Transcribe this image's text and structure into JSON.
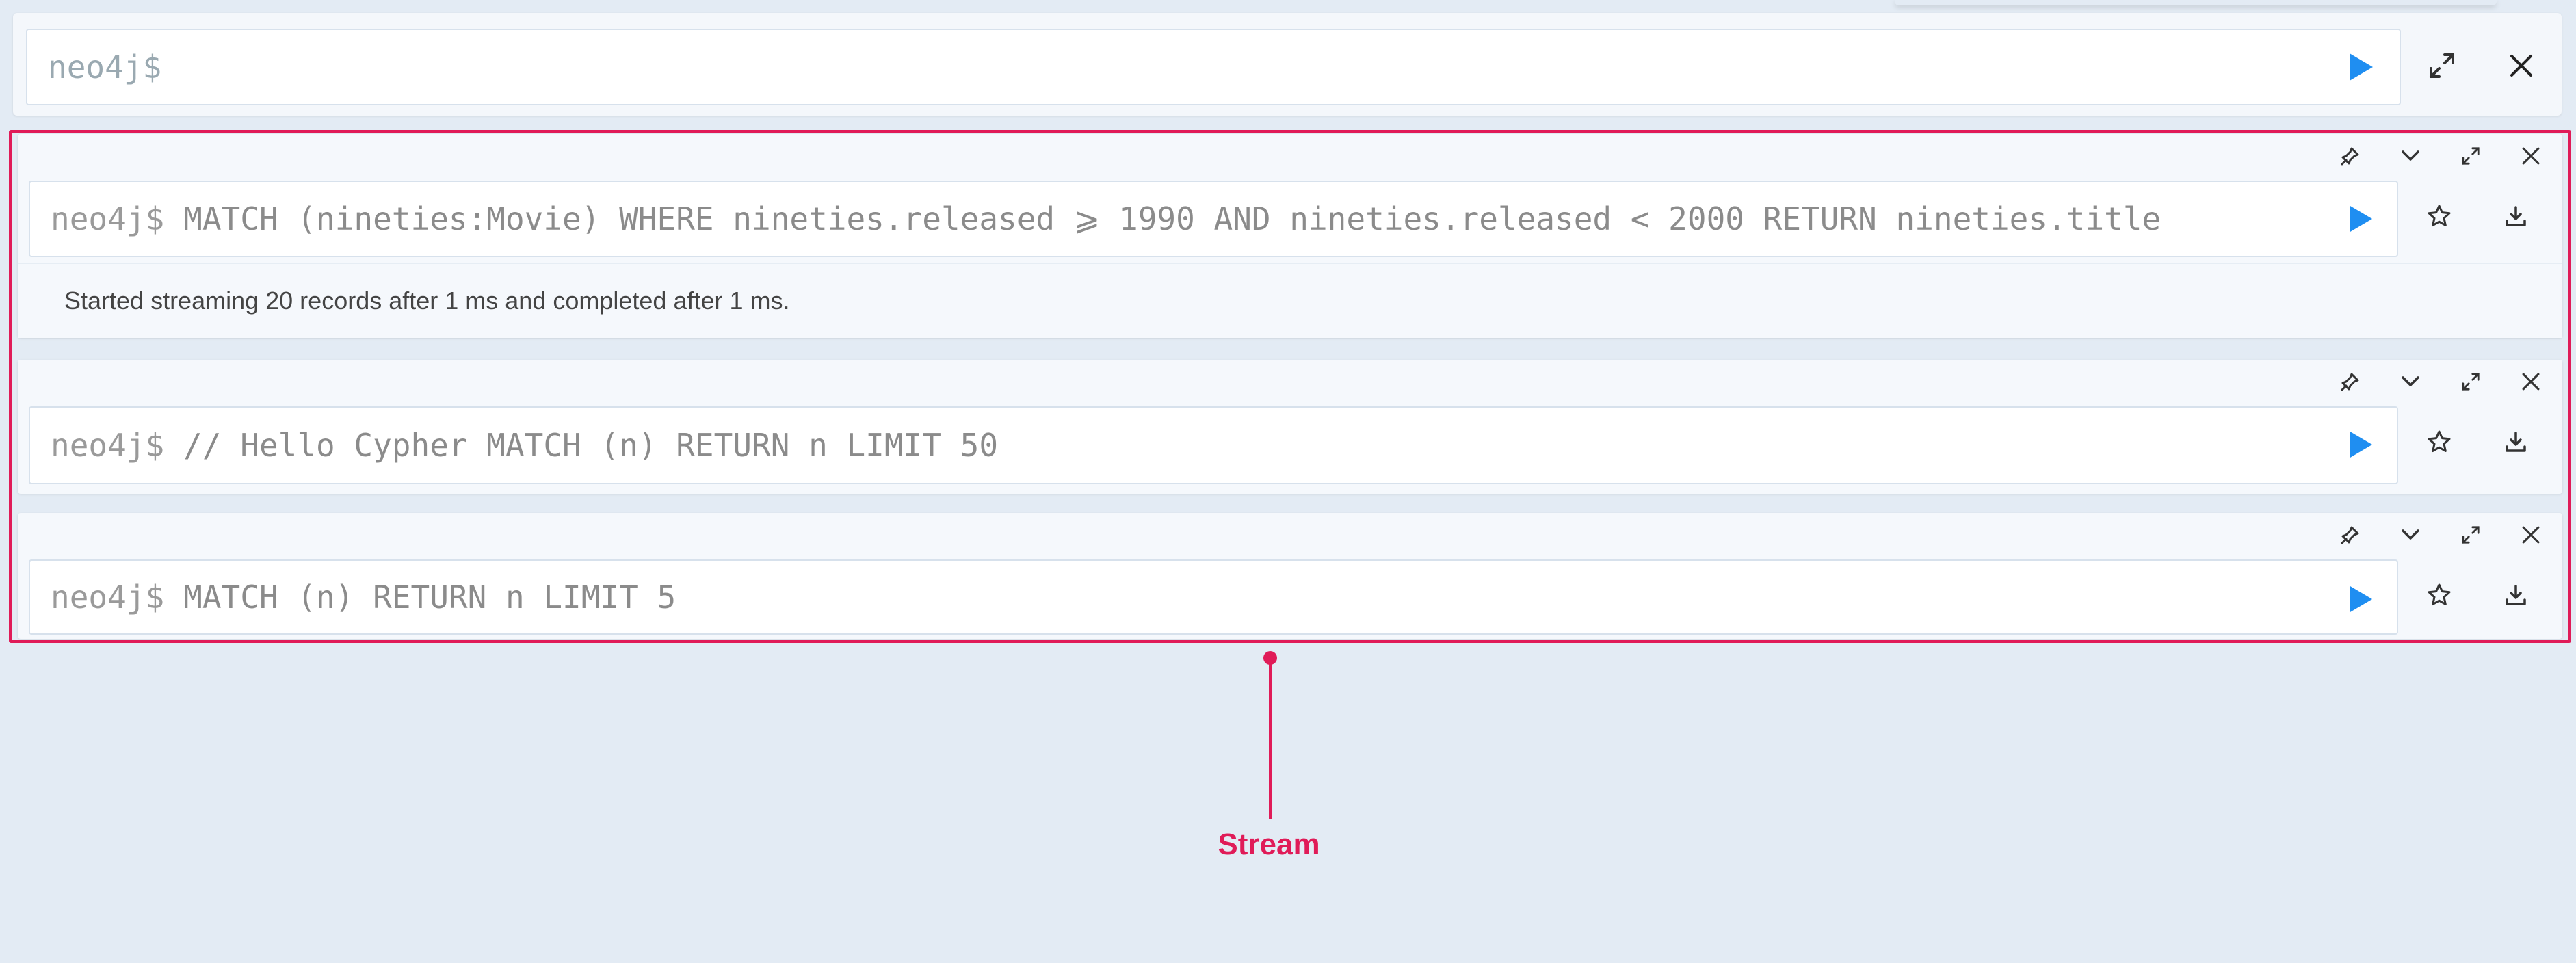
{
  "editor": {
    "prompt": "neo4j$"
  },
  "frames": [
    {
      "prompt": "neo4j$",
      "query": "MATCH (nineties:Movie) WHERE nineties.released  ⩾ 1990 AND nineties.released < 2000 RETURN nineties.title",
      "status": "Started streaming 20 records after 1 ms and completed after 1 ms."
    },
    {
      "prompt": "neo4j$",
      "query": "// Hello Cypher MATCH (n) RETURN n LIMIT 50"
    },
    {
      "prompt": "neo4j$",
      "query": "MATCH (n) RETURN n LIMIT 5"
    }
  ],
  "annotation": {
    "label": "Stream",
    "color": "#e01b58"
  },
  "colors": {
    "background": "#e3ebf4",
    "accent_play": "#1f8ef1"
  },
  "icons": [
    "play-icon",
    "expand-icon",
    "close-icon",
    "pin-icon",
    "collapse-chevron-icon",
    "star-icon",
    "download-icon"
  ]
}
